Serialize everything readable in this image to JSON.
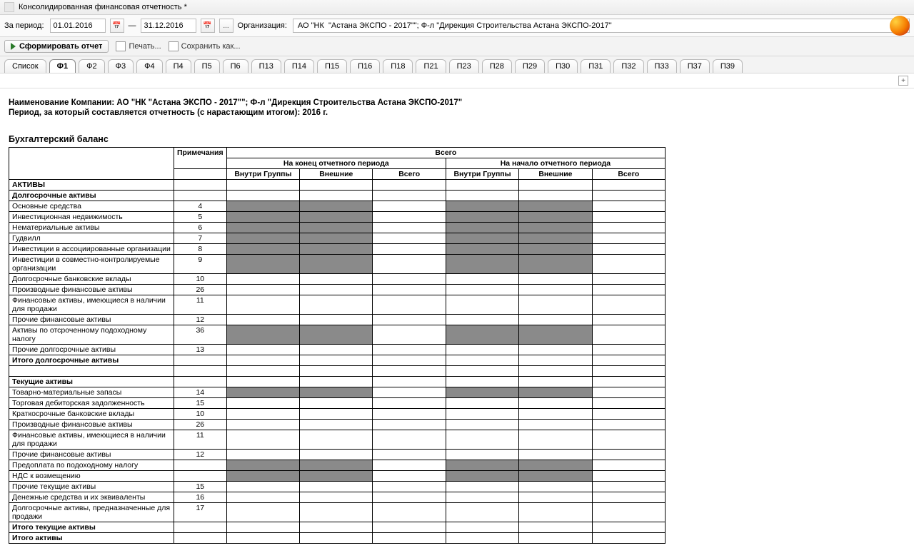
{
  "window": {
    "title": "Консолидированная финансовая отчетность *"
  },
  "filter": {
    "period_label": "За период:",
    "date_from": "01.01.2016",
    "date_to": "31.12.2016",
    "elipsis": "...",
    "org_label": "Организация:",
    "org_value": "АО \"НК  \"Астана ЭКСПО - 2017\"\"; Ф-л \"Дирекция Строительства Астана ЭКСПО-2017\""
  },
  "toolbar": {
    "run": "Сформировать отчет",
    "print": "Печать...",
    "save_as": "Сохранить как..."
  },
  "tabs": [
    "Список",
    "Ф1",
    "Ф2",
    "Ф3",
    "Ф4",
    "П4",
    "П5",
    "П6",
    "П13",
    "П14",
    "П15",
    "П16",
    "П18",
    "П21",
    "П23",
    "П28",
    "П29",
    "П30",
    "П31",
    "П32",
    "П33",
    "П37",
    "П39"
  ],
  "active_tab": "Ф1",
  "meta": {
    "line1_label": "Наименование Компании: ",
    "line1_value": "АО \"НК  \"Астана ЭКСПО - 2017\"\"; Ф-л \"Дирекция Строительства Астана ЭКСПО-2017\"",
    "line2_label": "Период, за который составляется отчетность (с нарастающим итогом): ",
    "line2_value": "2016 г."
  },
  "section": "Бухгалтерский баланс",
  "headers": {
    "total": "Всего",
    "notes": "Примечания",
    "end_period": "На конец отчетного периода",
    "begin_period": "На начало отчетного периода",
    "in_group": "Внутри Группы",
    "external": "Внешние",
    "sub_total": "Всего"
  },
  "rows": [
    {
      "name": "АКТИВЫ",
      "note": "",
      "bold": true,
      "shade": false
    },
    {
      "name": "Долгосрочные активы",
      "note": "",
      "bold": true,
      "shade": false
    },
    {
      "name": "Основные средства",
      "note": "4",
      "bold": false,
      "shade": true
    },
    {
      "name": "Инвестиционная недвижимость",
      "note": "5",
      "bold": false,
      "shade": true
    },
    {
      "name": "Нематериальные активы",
      "note": "6",
      "bold": false,
      "shade": true
    },
    {
      "name": "Гудвилл",
      "note": "7",
      "bold": false,
      "shade": true
    },
    {
      "name": "Инвестиции в ассоциированные организации",
      "note": "8",
      "bold": false,
      "shade": true
    },
    {
      "name": "Инвестиции в совместно-контролируемые организации",
      "note": "9",
      "bold": false,
      "shade": true
    },
    {
      "name": "Долгосрочные банковские вклады",
      "note": "10",
      "bold": false,
      "shade": false
    },
    {
      "name": "Производные финансовые активы",
      "note": "26",
      "bold": false,
      "shade": false
    },
    {
      "name": "Финансовые активы, имеющиеся в наличии для продажи",
      "note": "11",
      "bold": false,
      "shade": false
    },
    {
      "name": "Прочие финансовые активы",
      "note": "12",
      "bold": false,
      "shade": false
    },
    {
      "name": "Активы по отсроченному подоходному налогу",
      "note": "36",
      "bold": false,
      "shade": true
    },
    {
      "name": "Прочие долгосрочные активы",
      "note": "13",
      "bold": false,
      "shade": false
    },
    {
      "name": "Итого долгосрочные активы",
      "note": "",
      "bold": true,
      "shade": false
    },
    {
      "name": "",
      "note": "",
      "bold": false,
      "shade": false,
      "blank": true
    },
    {
      "name": "Текущие активы",
      "note": "",
      "bold": true,
      "shade": false
    },
    {
      "name": "Товарно-материальные запасы",
      "note": "14",
      "bold": false,
      "shade": true
    },
    {
      "name": "Торговая дебиторская задолженность",
      "note": "15",
      "bold": false,
      "shade": false
    },
    {
      "name": "Краткосрочные банковские вклады",
      "note": "10",
      "bold": false,
      "shade": false
    },
    {
      "name": "Производные финансовые активы",
      "note": "26",
      "bold": false,
      "shade": false
    },
    {
      "name": "Финансовые активы, имеющиеся в наличии для продажи",
      "note": "11",
      "bold": false,
      "shade": false
    },
    {
      "name": "Прочие финансовые активы",
      "note": "12",
      "bold": false,
      "shade": false
    },
    {
      "name": "Предоплата по подоходному налогу",
      "note": "",
      "bold": false,
      "shade": true
    },
    {
      "name": "НДС к возмещению",
      "note": "",
      "bold": false,
      "shade": true
    },
    {
      "name": "Прочие текущие активы",
      "note": "15",
      "bold": false,
      "shade": false
    },
    {
      "name": "Денежные средства и их эквиваленты",
      "note": "16",
      "bold": false,
      "shade": false
    },
    {
      "name": "Долгосрочные активы, предназначенные для продажи",
      "note": "17",
      "bold": false,
      "shade": false
    },
    {
      "name": "Итого текущие активы",
      "note": "",
      "bold": true,
      "shade": false
    },
    {
      "name": "Итого активы",
      "note": "",
      "bold": true,
      "shade": false
    }
  ]
}
